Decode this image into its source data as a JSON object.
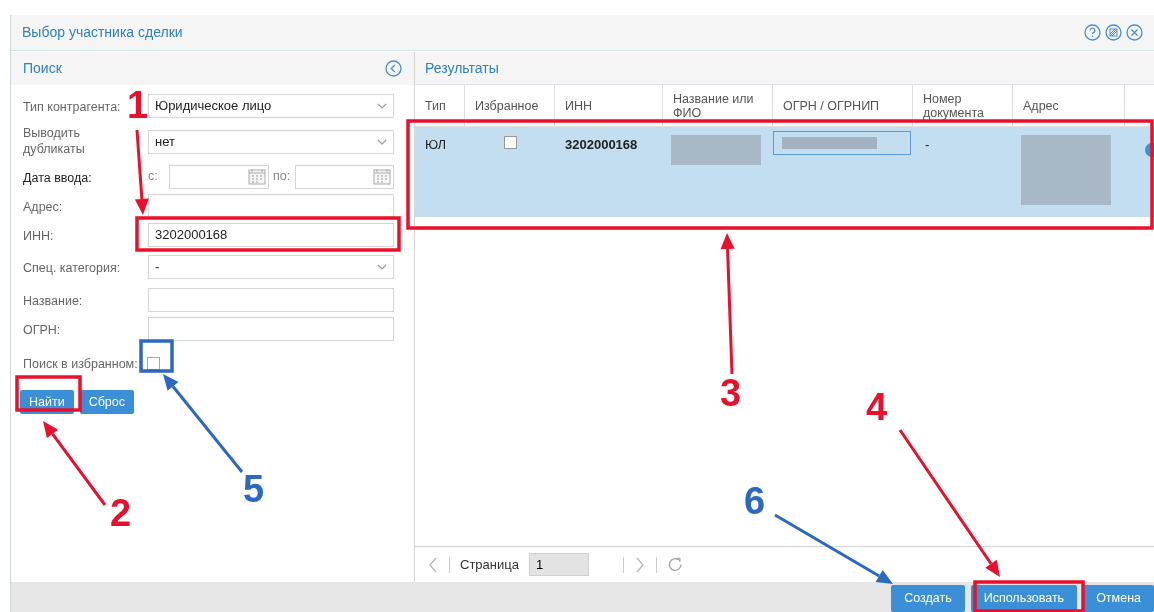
{
  "window": {
    "title": "Выбор участника сделки"
  },
  "search_panel": {
    "title": "Поиск",
    "fields": [
      {
        "kind": "select",
        "label": "Тип контрагента:",
        "value": "Юридическое лицо"
      },
      {
        "kind": "select",
        "label": "Выводить дубликаты",
        "value": "нет"
      },
      {
        "kind": "date_range",
        "label": "Дата ввода:",
        "from_label": "с:",
        "to_label": "по:"
      },
      {
        "kind": "text",
        "label": "Адрес:"
      },
      {
        "kind": "text",
        "label": "ИНН:",
        "value": "3202000168"
      },
      {
        "kind": "select",
        "label": "Спец. категория:",
        "value": "-"
      },
      {
        "kind": "text",
        "label": "Название:"
      },
      {
        "kind": "text",
        "label": "ОГРН:"
      },
      {
        "kind": "checkbox",
        "label": "Поиск в избранном:",
        "checked": false
      }
    ],
    "buttons": [
      "Найти",
      "Сброс"
    ]
  },
  "results_panel": {
    "title": "Результаты",
    "columns": [
      "Тип",
      "Избранное",
      "ИНН",
      "Название или ФИО",
      "ОГРН / ОГРНИП",
      "Номер документа",
      "Адрес"
    ],
    "rows": [
      {
        "type": "ЮЛ",
        "favorite": false,
        "inn": "3202000168",
        "document_number": "-",
        "selected": true
      }
    ],
    "pager": {
      "label": "Страница",
      "page": "1"
    }
  },
  "footer_buttons": [
    "Создать",
    "Использовать",
    "Отмена"
  ],
  "annotations": [
    {
      "label": "1",
      "color": "#e8102c"
    },
    {
      "label": "2",
      "color": "#e8102c"
    },
    {
      "label": "3",
      "color": "#e8102c"
    },
    {
      "label": "4",
      "color": "#e8102c"
    },
    {
      "label": "5",
      "color": "#2c68bf"
    },
    {
      "label": "6",
      "color": "#2c68bf"
    }
  ]
}
